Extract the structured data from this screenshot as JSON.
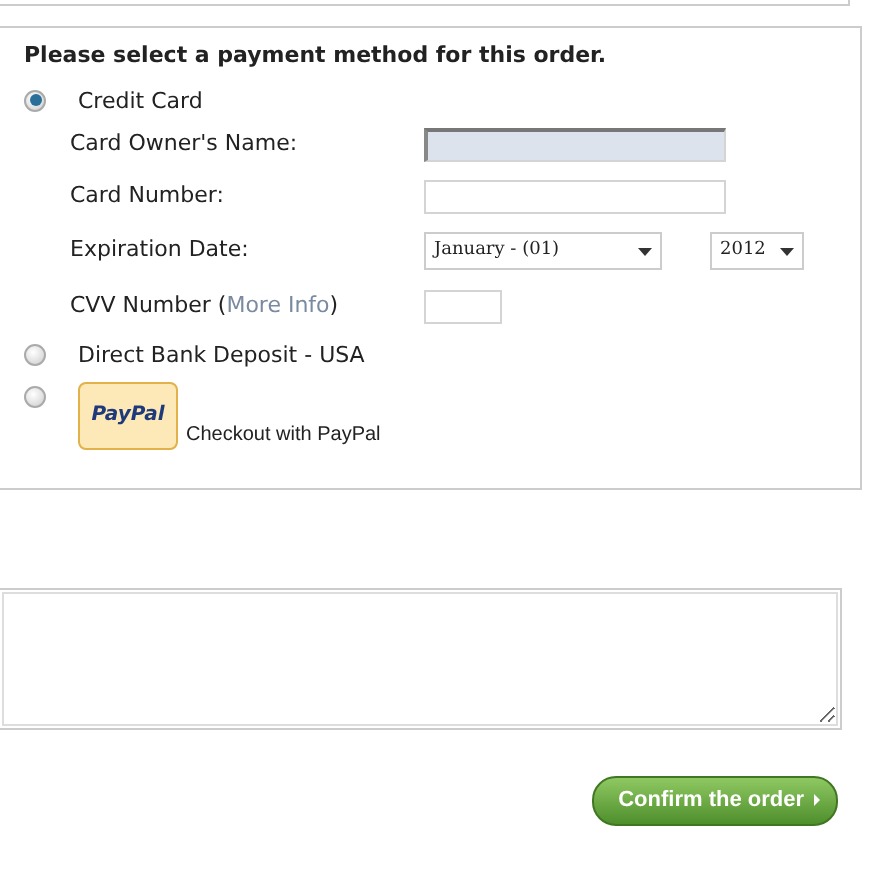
{
  "heading": "Please select a payment method for this order.",
  "payment_methods": [
    {
      "kind": "card",
      "label": "Credit Card",
      "selected": true,
      "fields": [
        {
          "kind": "text",
          "label": "Card Owner's Name:",
          "focused": true
        },
        {
          "kind": "text",
          "label": "Card Number:",
          "focused": false
        },
        {
          "kind": "select",
          "label": "Expiration Date:",
          "values": [
            "January - (01)",
            "2012"
          ]
        },
        {
          "kind": "cvv",
          "label_before": "CVV Number (",
          "link": "More Info",
          "label_after": ")",
          "focused": false
        }
      ]
    },
    {
      "kind": "plain",
      "label": "Direct Bank Deposit - USA",
      "selected": false
    },
    {
      "kind": "paypal",
      "logo_text": "PayPal",
      "label": "Checkout with PayPal",
      "selected": false
    }
  ],
  "confirm_button": "Confirm the order"
}
